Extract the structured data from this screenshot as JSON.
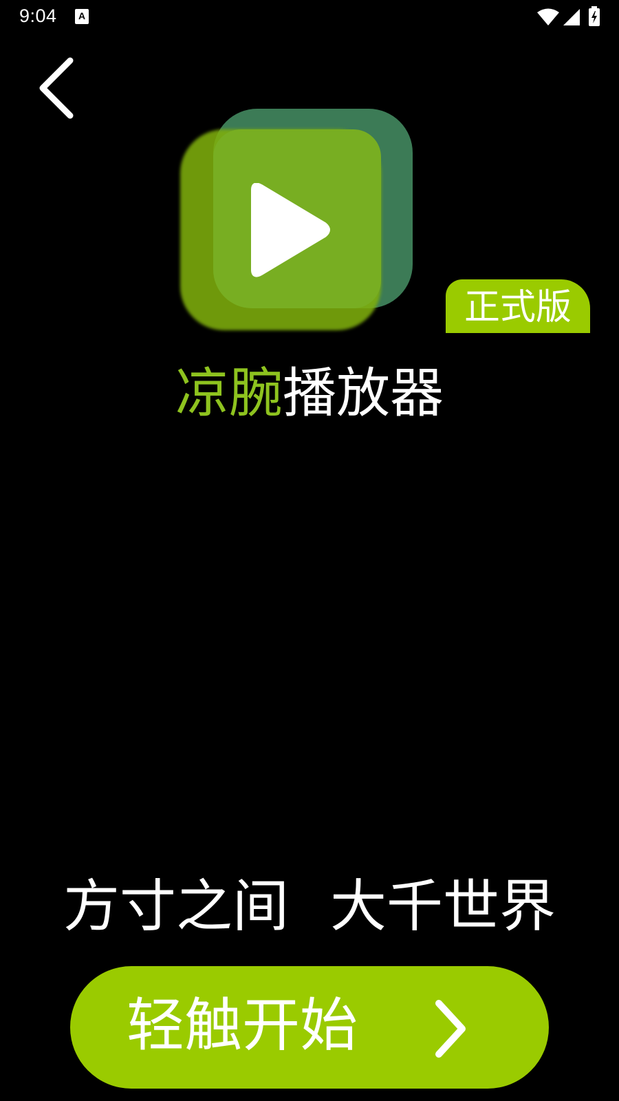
{
  "status_bar": {
    "time": "9:04",
    "notification_icon": "a-icon",
    "wifi_icon": "wifi-icon",
    "signal_icon": "signal-icon",
    "battery_icon": "battery-charging-icon"
  },
  "nav": {
    "back_icon": "chevron-left-icon"
  },
  "logo": {
    "icon": "play-icon"
  },
  "badge": {
    "label": "正式版"
  },
  "title": {
    "accent": "凉腕",
    "rest": "播放器"
  },
  "slogan": {
    "part1": "方寸之间",
    "part2": "大千世界"
  },
  "start_button": {
    "label": "轻触开始",
    "icon": "chevron-right-icon"
  },
  "colors": {
    "background": "#000000",
    "accent_green": "#9acb00",
    "title_green": "#8ec31f",
    "logo_dark_green": "#3c7b56",
    "text": "#ffffff"
  }
}
